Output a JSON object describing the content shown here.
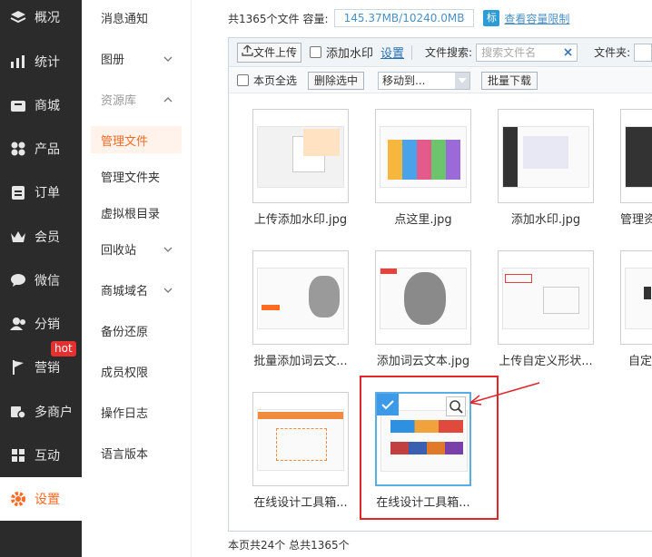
{
  "nav": {
    "items": [
      {
        "label": "概况",
        "icon": "layers-icon"
      },
      {
        "label": "统计",
        "icon": "chart-icon"
      },
      {
        "label": "商城",
        "icon": "shop-icon"
      },
      {
        "label": "产品",
        "icon": "grid-icon"
      },
      {
        "label": "订单",
        "icon": "clipboard-icon"
      },
      {
        "label": "会员",
        "icon": "crown-icon"
      },
      {
        "label": "微信",
        "icon": "chat-icon"
      },
      {
        "label": "分销",
        "icon": "users-icon"
      },
      {
        "label": "营销",
        "icon": "flag-icon"
      },
      {
        "label": "多商户",
        "icon": "merchant-icon"
      },
      {
        "label": "互动",
        "icon": "interact-icon"
      },
      {
        "label": "设置",
        "icon": "gear-icon"
      }
    ],
    "hot_badge": "hot",
    "active_color": "#ff6a22"
  },
  "submenu": {
    "items": [
      {
        "label": "消息通知"
      },
      {
        "label": "图册"
      },
      {
        "label": "资源库"
      },
      {
        "label": "管理文件"
      },
      {
        "label": "管理文件夹"
      },
      {
        "label": "虚拟根目录"
      },
      {
        "label": "回收站"
      },
      {
        "label": "商城域名"
      },
      {
        "label": "备份还原"
      },
      {
        "label": "成员权限"
      },
      {
        "label": "操作日志"
      },
      {
        "label": "语言版本"
      }
    ]
  },
  "summary": {
    "file_count": "共1365个文件",
    "capacity_label": "容量:",
    "capacity_value": "145.37MB/10240.0MB",
    "capacity_icon_text": "标",
    "capacity_link": "查看容量限制"
  },
  "toolbar": {
    "upload": "文件上传",
    "watermark": "添加水印",
    "settings": "设置",
    "search_label": "文件搜索:",
    "search_placeholder": "搜索文件名",
    "folder_label": "文件夹:",
    "select_all": "本页全选",
    "delete_selected": "删除选中",
    "move_to": "移动到...",
    "batch_download": "批量下载"
  },
  "files": [
    {
      "name": "上传添加水印.jpg"
    },
    {
      "name": "点这里.jpg"
    },
    {
      "name": "添加水印.jpg"
    },
    {
      "name": "管理资"
    },
    {
      "name": "批量添加词云文..."
    },
    {
      "name": "添加词云文本.jpg"
    },
    {
      "name": "上传自定义形状..."
    },
    {
      "name": "自定"
    },
    {
      "name": "在线设计工具箱..."
    },
    {
      "name": "在线设计工具箱..."
    }
  ],
  "footer": "本页共24个 总共1365个"
}
